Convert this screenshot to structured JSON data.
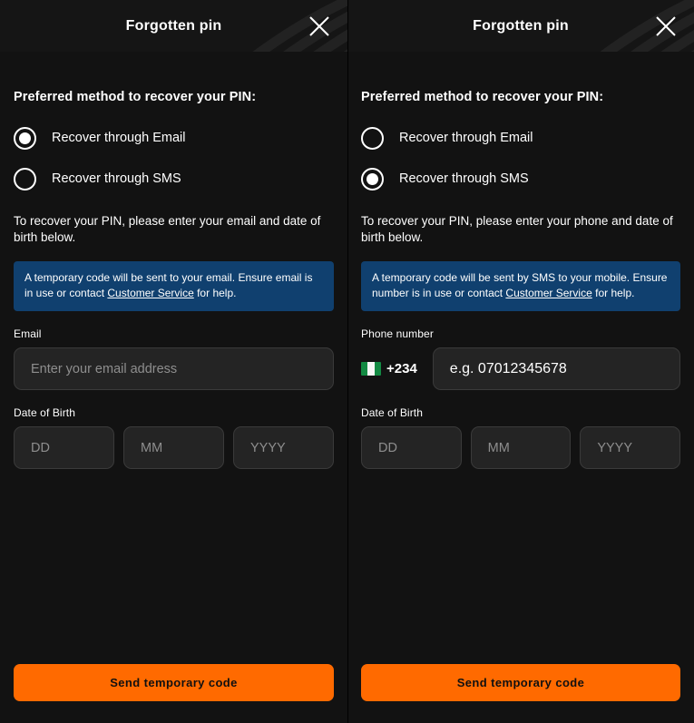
{
  "panels": [
    {
      "header": {
        "title": "Forgotten pin",
        "close_icon": "close-icon"
      },
      "section_title": "Preferred method to recover your PIN:",
      "radios": [
        {
          "label": "Recover through Email",
          "selected": true
        },
        {
          "label": "Recover through SMS",
          "selected": false
        }
      ],
      "helper_text": "To recover your PIN, please enter your email and date of birth below.",
      "banner": {
        "before_link": "A temporary code will be sent to your email. Ensure email is in use or contact ",
        "link": "Customer Service",
        "after_link": " for help."
      },
      "field_label": "Email",
      "input_placeholder": "Enter your email address",
      "dob_label": "Date of Birth",
      "dob_placeholders": [
        "DD",
        "MM",
        "YYYY"
      ],
      "submit_label": "Send temporary code"
    },
    {
      "header": {
        "title": "Forgotten pin",
        "close_icon": "close-icon"
      },
      "section_title": "Preferred method to recover your PIN:",
      "radios": [
        {
          "label": "Recover through Email",
          "selected": false
        },
        {
          "label": "Recover through SMS",
          "selected": true
        }
      ],
      "helper_text": "To recover your PIN, please enter your phone and date of birth below.",
      "banner": {
        "before_link": "A temporary code will be sent by SMS to your mobile. Ensure number is in use or contact ",
        "link": "Customer Service",
        "after_link": " for help."
      },
      "field_label": "Phone number",
      "phone_prefix": "+234",
      "phone_flag": "nigeria-flag-icon",
      "input_placeholder": "e.g. 07012345678",
      "dob_label": "Date of Birth",
      "dob_placeholders": [
        "DD",
        "MM",
        "YYYY"
      ],
      "submit_label": "Send temporary code"
    }
  ],
  "colors": {
    "background": "#121212",
    "header": "#151515",
    "accent_orange": "#ff6a00",
    "banner_blue": "#10406f",
    "input_fill": "#242424",
    "input_border": "#3a3a3a",
    "placeholder": "#8e8e8e"
  }
}
